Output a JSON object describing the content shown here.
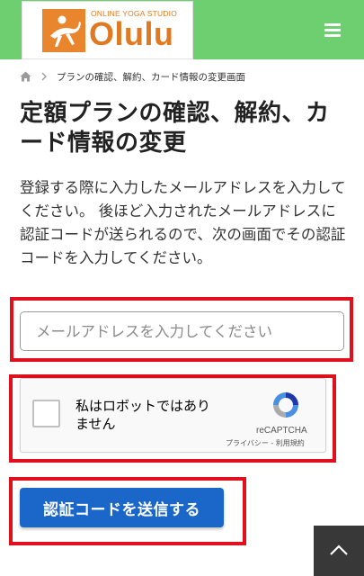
{
  "header": {
    "logo_sub": "ONLINE YOGA STUDIO",
    "logo_main": "Olulu",
    "bg_color": "#6dcf6f",
    "brand_color": "#e07a22"
  },
  "breadcrumb": {
    "home_icon": "home-icon",
    "current": "プランの確認、解約、カード情報の変更画面"
  },
  "page": {
    "title": "定額プランの確認、解約、カード情報の変更",
    "description": "登録する際に入力したメールアドレスを入力してください。 後ほど入力されたメールアドレスに認証コードが送られるので、次の画面でその認証コードを入力してください。"
  },
  "form": {
    "email_placeholder": "メールアドレスを入力してください",
    "email_value": "",
    "recaptcha_label": "私はロボットではありません",
    "recaptcha_brand": "reCAPTCHA",
    "recaptcha_links": "プライバシー - 利用規約",
    "submit_label": "認証コードを送信する",
    "submit_color": "#1a66c9",
    "highlight_color": "#e0101c"
  }
}
